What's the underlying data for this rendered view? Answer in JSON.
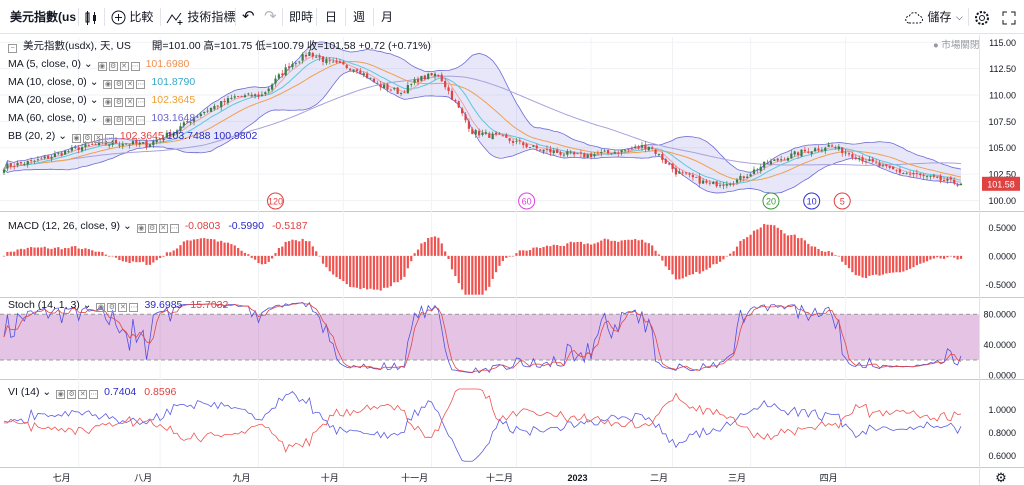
{
  "toolbar": {
    "symbol": "美元指數(us",
    "compare": "比較",
    "indicators": "技術指標",
    "interval": "即時",
    "btn_d": "日",
    "btn_w": "週",
    "btn_m": "月",
    "save": "儲存"
  },
  "colors": {
    "up": "#3a7d44",
    "down": "#e04141",
    "ma5": "#e8a7a7",
    "ma10": "#5ec8d8",
    "ma20": "#f0a050",
    "ma60": "#a7a2dc",
    "bb": "#6b6bd6",
    "bbfill": "rgba(110,110,220,0.17)",
    "macd": "#ef5350",
    "stochK": "#5050e0",
    "stochD": "#e04848",
    "stochBand": "rgba(160,40,160,0.28)",
    "viPlus": "#5b5be6",
    "viMinus": "#ef5454"
  },
  "legend": {
    "main_title": "美元指數(usdx), 天, US",
    "ohlc": "開=101.00  高=101.75  低=100.79  收=101.58  +0.72 (+0.71%)",
    "market_status": "● 市場關閉",
    "ma5": {
      "label": "MA (5, close, 0)",
      "value": "101.6980"
    },
    "ma10": {
      "label": "MA (10, close, 0)",
      "value": "101.8790"
    },
    "ma20": {
      "label": "MA (20, close, 0)",
      "value": "102.3645"
    },
    "ma60": {
      "label": "MA (60, close, 0)",
      "value": "103.1648"
    },
    "bb": {
      "label": "BB (20, 2)",
      "v1": "102.3645",
      "v2": "103.7488",
      "v3": "100.9802"
    },
    "macd": {
      "label": "MACD (12, 26, close, 9)",
      "v1": "-0.0803",
      "v2": "-0.5990",
      "v3": "-0.5187"
    },
    "stoch": {
      "label": "Stoch (14, 1, 3)",
      "v1": "39.6985",
      "v2": "15.7032"
    },
    "vi": {
      "label": "VI (14)",
      "v1": "0.7404",
      "v2": "0.8596"
    }
  },
  "markers": [
    {
      "label": "120",
      "color": "#e04141"
    },
    {
      "label": "60",
      "color": "#e040e0"
    },
    {
      "label": "20",
      "color": "#3a9a3a"
    },
    {
      "label": "10",
      "color": "#3030d0"
    },
    {
      "label": "5",
      "color": "#e04141"
    }
  ],
  "last_price": "101.58",
  "x_labels": [
    "七月",
    "八月",
    "九月",
    "十月",
    "十一月",
    "十二月",
    "2023",
    "二月",
    "三月",
    "四月"
  ],
  "chart_data": {
    "type": "candlestick",
    "main": {
      "ylim": [
        99.0,
        115.5
      ],
      "ticks": [
        "115.00",
        "112.50",
        "110.00",
        "107.50",
        "105.00",
        "102.50",
        "100.00"
      ],
      "tick_values": [
        115,
        112.5,
        110,
        107.5,
        105,
        102.5,
        100
      ],
      "close_anchors": [
        [
          0,
          103.2
        ],
        [
          10,
          103.8
        ],
        [
          22,
          105.0
        ],
        [
          33,
          105.5
        ],
        [
          42,
          105.3
        ],
        [
          50,
          106.5
        ],
        [
          58,
          108.3
        ],
        [
          68,
          109.8
        ],
        [
          76,
          110.0
        ],
        [
          84,
          112.8
        ],
        [
          90,
          114.0
        ],
        [
          96,
          113.0
        ],
        [
          104,
          112.5
        ],
        [
          110,
          111.0
        ],
        [
          117,
          110.2
        ],
        [
          122,
          111.5
        ],
        [
          128,
          112.0
        ],
        [
          138,
          106.5
        ],
        [
          146,
          106.0
        ],
        [
          158,
          104.8
        ],
        [
          170,
          104.2
        ],
        [
          180,
          104.6
        ],
        [
          190,
          105.2
        ],
        [
          198,
          102.7
        ],
        [
          208,
          101.5
        ],
        [
          216,
          101.9
        ],
        [
          224,
          103.4
        ],
        [
          234,
          104.5
        ],
        [
          243,
          105.2
        ],
        [
          248,
          104.6
        ],
        [
          260,
          103.0
        ],
        [
          270,
          102.3
        ],
        [
          278,
          101.8
        ],
        [
          282,
          101.58
        ]
      ]
    },
    "macd": {
      "ticks": [
        "0.5000",
        "0.0000",
        "-0.5000"
      ],
      "tick_values": [
        0.5,
        0,
        -0.5
      ],
      "ylim": [
        -0.72,
        0.75
      ]
    },
    "stoch": {
      "ticks": [
        "80.0000",
        "40.0000",
        "0.0000"
      ],
      "tick_values": [
        80,
        40,
        0
      ],
      "ylim": [
        -5,
        100
      ],
      "band": [
        20,
        80
      ]
    },
    "vi": {
      "ticks": [
        "1.0000",
        "0.8000",
        "0.6000"
      ],
      "tick_values": [
        1.0,
        0.8,
        0.6
      ],
      "ylim": [
        0.5,
        1.25
      ]
    }
  }
}
